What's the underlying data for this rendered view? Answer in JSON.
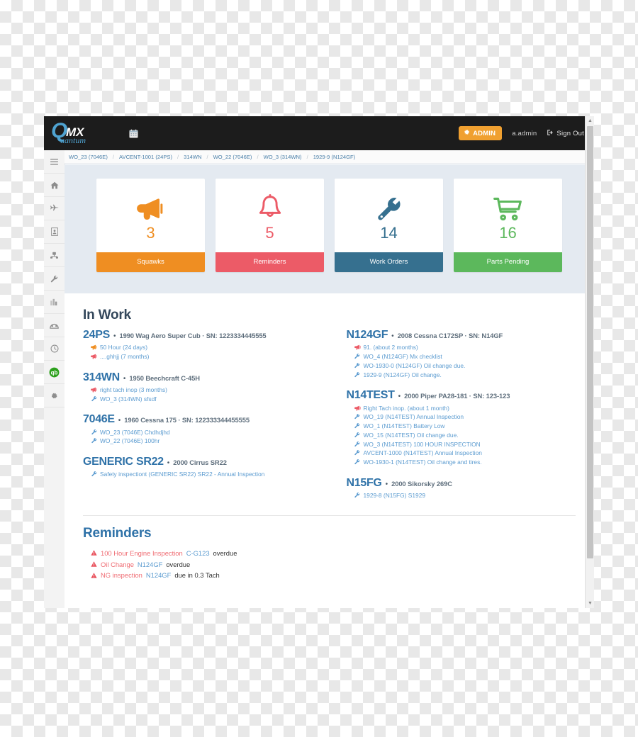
{
  "navbar": {
    "logo_main": "MX",
    "logo_q": "Q",
    "logo_sub": "uantum",
    "calendar_icon": "calendar-icon",
    "admin_label": "ADMIN",
    "admin_icon": "gear-icon",
    "user": "a.admin",
    "signout_label": "Sign Out",
    "signout_icon": "sign-out-icon",
    "admin_color": "#f0a030"
  },
  "rail": {
    "items": [
      {
        "icon": "hamburger-menu-icon",
        "name": "sidebar-toggle"
      },
      {
        "icon": "home-icon",
        "name": "sidebar-item-home"
      },
      {
        "icon": "plane-icon",
        "name": "sidebar-item-aircraft"
      },
      {
        "icon": "logbook-icon",
        "name": "sidebar-item-logbook"
      },
      {
        "icon": "parts-icon",
        "name": "sidebar-item-parts"
      },
      {
        "icon": "wrench-icon",
        "name": "sidebar-item-maintenance"
      },
      {
        "icon": "chart-bar-icon",
        "name": "sidebar-item-reports"
      },
      {
        "icon": "gauge-icon",
        "name": "sidebar-item-dashboard"
      },
      {
        "icon": "clock-icon",
        "name": "sidebar-item-history"
      },
      {
        "icon": "quickbooks-icon",
        "name": "sidebar-item-quickbooks"
      },
      {
        "icon": "gear-icon",
        "name": "sidebar-item-settings"
      }
    ]
  },
  "breadcrumb": {
    "separator": "/",
    "items": [
      "WO_23 (7046E)",
      "AVCENT-1001 (24PS)",
      "314WN",
      "WO_22 (7046E)",
      "WO_3 (314WN)",
      "1929-9 (N124GF)"
    ]
  },
  "stats": [
    {
      "icon": "megaphone-icon",
      "count": "3",
      "label": "Squawks",
      "color": "#ef8e22"
    },
    {
      "icon": "bell-icon",
      "count": "5",
      "label": "Reminders",
      "color": "#ec5b67"
    },
    {
      "icon": "wrench-icon",
      "count": "14",
      "label": "Work Orders",
      "color": "#36708f"
    },
    {
      "icon": "cart-icon",
      "count": "16",
      "label": "Parts Pending",
      "color": "#5cb85c"
    }
  ],
  "in_work": {
    "title": "In Work",
    "separator": "•",
    "left": [
      {
        "reg": "24PS",
        "desc": "1990 Wag Aero Super Cub · SN: 1223334445555",
        "items": [
          {
            "icon": "megaphone-icon",
            "icon_color": "#ef8e22",
            "text": "50 Hour (24 days)"
          },
          {
            "icon": "megaphone-icon",
            "icon_color": "#ec5b67",
            "text": "....ghhjj (7 months)"
          }
        ]
      },
      {
        "reg": "314WN",
        "desc": "1950 Beechcraft C-45H",
        "items": [
          {
            "icon": "megaphone-icon",
            "icon_color": "#ec5b67",
            "text": "right tach inop (3 months)"
          },
          {
            "icon": "wrench-icon",
            "icon_color": "#5b9bd0",
            "text": "WO_3 (314WN) sfsdf"
          }
        ]
      },
      {
        "reg": "7046E",
        "desc": "1960 Cessna 175 · SN: 122333344455555",
        "items": [
          {
            "icon": "wrench-icon",
            "icon_color": "#5b9bd0",
            "text": "WO_23 (7046E) Chdhdjhd"
          },
          {
            "icon": "wrench-icon",
            "icon_color": "#5b9bd0",
            "text": "WO_22 (7046E) 100hr"
          }
        ]
      },
      {
        "reg": "GENERIC SR22",
        "desc": "2000 Cirrus SR22",
        "items": [
          {
            "icon": "wrench-icon",
            "icon_color": "#5b9bd0",
            "text": "Safety inspectiont (GENERIC SR22) SR22 - Annual Inspection"
          }
        ]
      }
    ],
    "right": [
      {
        "reg": "N124GF",
        "desc": "2008 Cessna C172SP · SN: N14GF",
        "items": [
          {
            "icon": "megaphone-icon",
            "icon_color": "#ec5b67",
            "text": "91. (about 2 months)"
          },
          {
            "icon": "wrench-icon",
            "icon_color": "#5b9bd0",
            "text": "WO_4 (N124GF) Mx checklist"
          },
          {
            "icon": "wrench-icon",
            "icon_color": "#5b9bd0",
            "text": "WO-1930-0 (N124GF) Oil change due."
          },
          {
            "icon": "wrench-icon",
            "icon_color": "#5b9bd0",
            "text": "1929-9 (N124GF) Oil change."
          }
        ]
      },
      {
        "reg": "N14TEST",
        "desc": "2000 Piper PA28-181 · SN: 123-123",
        "items": [
          {
            "icon": "megaphone-icon",
            "icon_color": "#ec5b67",
            "text": "Right Tach inop. (about 1 month)"
          },
          {
            "icon": "wrench-icon",
            "icon_color": "#5b9bd0",
            "text": "WO_19 (N14TEST) Annual Inspection"
          },
          {
            "icon": "wrench-icon",
            "icon_color": "#5b9bd0",
            "text": "WO_1 (N14TEST) Battery Low"
          },
          {
            "icon": "wrench-icon",
            "icon_color": "#5b9bd0",
            "text": "WO_15 (N14TEST) Oil change due."
          },
          {
            "icon": "wrench-icon",
            "icon_color": "#5b9bd0",
            "text": "WO_3 (N14TEST) 100 HOUR INSPECTION"
          },
          {
            "icon": "wrench-icon",
            "icon_color": "#5b9bd0",
            "text": "AVCENT-1000 (N14TEST) Annual Inspection"
          },
          {
            "icon": "wrench-icon",
            "icon_color": "#5b9bd0",
            "text": "WO-1930-1 (N14TEST) Oil change and tires."
          }
        ]
      },
      {
        "reg": "N15FG",
        "desc": "2000 Sikorsky 269C",
        "items": [
          {
            "icon": "wrench-icon",
            "icon_color": "#5b9bd0",
            "text": "1929-8 (N15FG) S1929"
          }
        ]
      }
    ]
  },
  "reminders": {
    "title": "Reminders",
    "items": [
      {
        "icon": "warning-triangle-icon",
        "link": "100 Hour Engine Inspection",
        "aircraft": "C-G123",
        "status": "overdue"
      },
      {
        "icon": "warning-triangle-icon",
        "link": "Oil Change",
        "aircraft": "N124GF",
        "status": "overdue"
      },
      {
        "icon": "warning-triangle-icon",
        "link": "NG inspection",
        "aircraft": "N124GF",
        "status": "due in 0.3 Tach"
      }
    ]
  },
  "scrollbar": {
    "up_arrow": "▲",
    "down_arrow": "▼"
  }
}
